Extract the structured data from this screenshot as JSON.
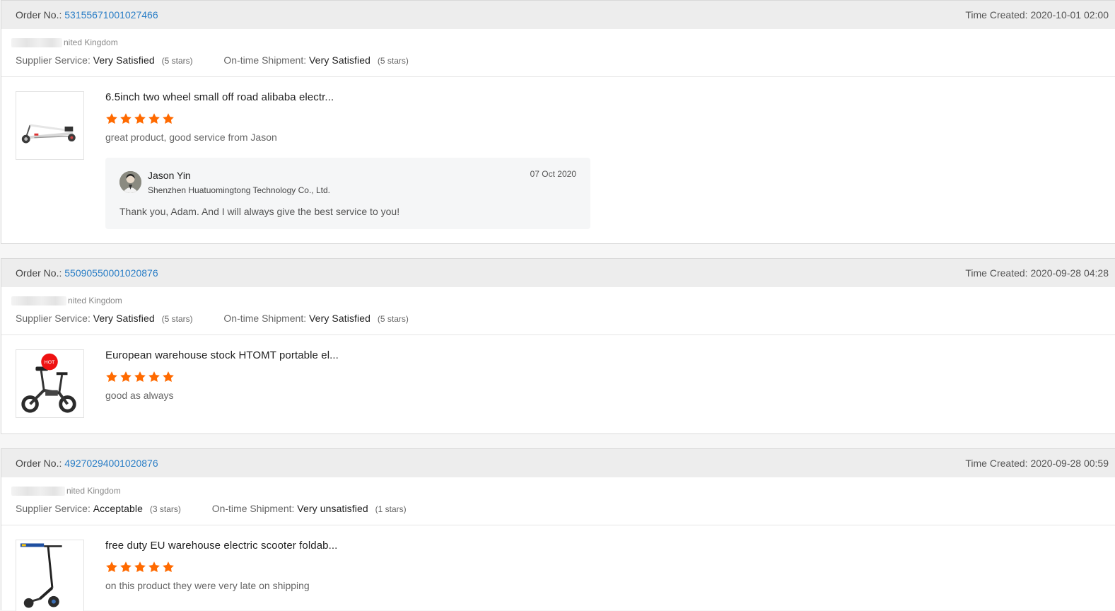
{
  "colors": {
    "link": "#2a7ec6",
    "star": "#ff6a00",
    "header_bg": "#ededed"
  },
  "labels": {
    "order_no": "Order No.:",
    "time_created": "Time Created:",
    "supplier_service": "Supplier Service:",
    "ontime_shipment": "On-time Shipment:"
  },
  "orders": [
    {
      "order_no": "53155671001027466",
      "time_created": "2020-10-01 02:00",
      "buyer_country": "nited Kingdom",
      "supplier_service": "Very Satisfied",
      "supplier_stars": "(5 stars)",
      "shipment": "Very Satisfied",
      "shipment_stars": "(5 stars)",
      "product_title": "6.5inch two wheel small off road alibaba electr...",
      "product_rating": 5,
      "review": "great product, good service from Jason",
      "reply": {
        "name": "Jason Yin",
        "company": "Shenzhen Huatuomingtong Technology Co., Ltd.",
        "date": "07 Oct 2020",
        "text": "Thank you, Adam. And I will always give the best service to you!"
      }
    },
    {
      "order_no": "55090550001020876",
      "time_created": "2020-09-28 04:28",
      "buyer_country": "nited Kingdom",
      "supplier_service": "Very Satisfied",
      "supplier_stars": "(5 stars)",
      "shipment": "Very Satisfied",
      "shipment_stars": "(5 stars)",
      "product_title": "European warehouse stock HTOMT portable el...",
      "product_rating": 5,
      "review": "good as always"
    },
    {
      "order_no": "49270294001020876",
      "time_created": "2020-09-28 00:59",
      "buyer_country": "nited Kingdom",
      "supplier_service": "Acceptable",
      "supplier_stars": "(3 stars)",
      "shipment": "Very unsatisfied",
      "shipment_stars": "(1 stars)",
      "product_title": "free duty EU warehouse electric scooter foldab...",
      "product_rating": 5,
      "review": "on this product they were very late on shipping"
    }
  ]
}
